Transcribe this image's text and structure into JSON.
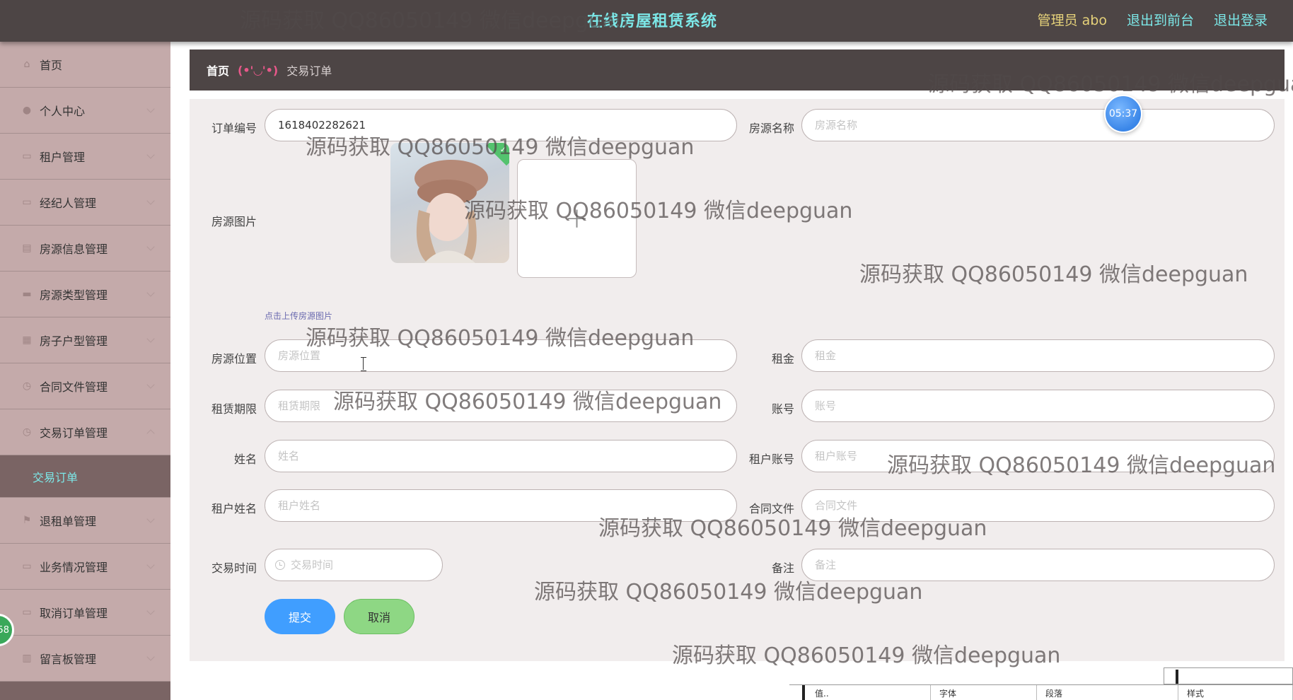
{
  "header": {
    "app_title": "在线房屋租赁系统",
    "admin_label": "管理员 abo",
    "back_to_front": "退出到前台",
    "logout": "退出登录"
  },
  "sidebar": {
    "items": [
      {
        "label": "首页",
        "icon": "home-icon"
      },
      {
        "label": "个人中心",
        "icon": "user-icon"
      },
      {
        "label": "租户管理",
        "icon": "list-icon"
      },
      {
        "label": "经纪人管理",
        "icon": "list-icon"
      },
      {
        "label": "房源信息管理",
        "icon": "building-icon"
      },
      {
        "label": "房源类型管理",
        "icon": "monitor-icon"
      },
      {
        "label": "房子户型管理",
        "icon": "grid-icon"
      },
      {
        "label": "合同文件管理",
        "icon": "clock-icon"
      },
      {
        "label": "交易订单管理",
        "icon": "clock-icon"
      },
      {
        "label": "退租单管理",
        "icon": "flag-icon"
      },
      {
        "label": "业务情况管理",
        "icon": "list-icon"
      },
      {
        "label": "取消订单管理",
        "icon": "list-icon"
      },
      {
        "label": "留言板管理",
        "icon": "chart-icon"
      }
    ],
    "active_sub": "交易订单",
    "badge": "58"
  },
  "breadcrumb": {
    "home": "首页",
    "separator": "(•'◡'•)",
    "current": "交易订单"
  },
  "form": {
    "order_no": {
      "label": "订单编号",
      "value": "1618402282621"
    },
    "house_name": {
      "label": "房源名称",
      "placeholder": "房源名称"
    },
    "house_image": {
      "label": "房源图片",
      "hint": "点击上传房源图片"
    },
    "house_location": {
      "label": "房源位置",
      "placeholder": "房源位置"
    },
    "rent": {
      "label": "租金",
      "placeholder": "租金"
    },
    "lease_term": {
      "label": "租赁期限",
      "placeholder": "租赁期限"
    },
    "account": {
      "label": "账号",
      "placeholder": "账号"
    },
    "name": {
      "label": "姓名",
      "placeholder": "姓名"
    },
    "tenant_account": {
      "label": "租户账号",
      "placeholder": "租户账号"
    },
    "tenant_name": {
      "label": "租户姓名",
      "placeholder": "租户姓名"
    },
    "contract_file": {
      "label": "合同文件",
      "placeholder": "合同文件"
    },
    "trade_time": {
      "label": "交易时间",
      "placeholder": "交易时间"
    },
    "remark": {
      "label": "备注",
      "placeholder": "备注"
    },
    "submit": "提交",
    "cancel": "取消"
  },
  "timer": "05:37",
  "toolbar_fragment": [
    "值..",
    "字体",
    "段落",
    "样式"
  ],
  "watermark": "源码获取 QQ86050149 微信deepguan",
  "colors": {
    "topbar": "#4d4545",
    "accent_cyan": "#7ce8e8",
    "sidebar_item": "#c4aaaa",
    "submit": "#409eff",
    "cancel": "#8ed784"
  }
}
